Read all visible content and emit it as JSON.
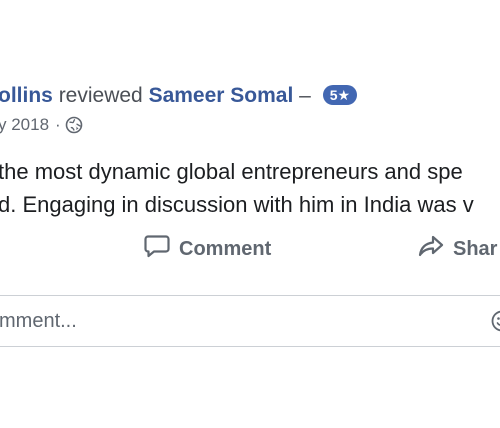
{
  "review": {
    "reviewer_name": "ollins",
    "action_text": "reviewed",
    "reviewee_name": "Sameer Somal",
    "dash": "–",
    "rating": "5★",
    "date": "y 2018",
    "date_separator": "·",
    "privacy_icon": "globe-icon",
    "body_lines": [
      " the most dynamic global entrepreneurs and spe",
      "d. Engaging in discussion with him in India was v"
    ]
  },
  "actions": {
    "comment_label": "Comment",
    "comment_icon": "speech-bubble-icon",
    "share_label": "Shar",
    "share_icon": "share-arrow-icon"
  },
  "composer": {
    "placeholder": "mment...",
    "emoji_icon": "emoji-icon"
  },
  "colors": {
    "link": "#385898",
    "badge": "#4267b2",
    "meta": "#616770",
    "action": "#606770",
    "text": "#1c1e21",
    "border": "#ccd0d5"
  }
}
